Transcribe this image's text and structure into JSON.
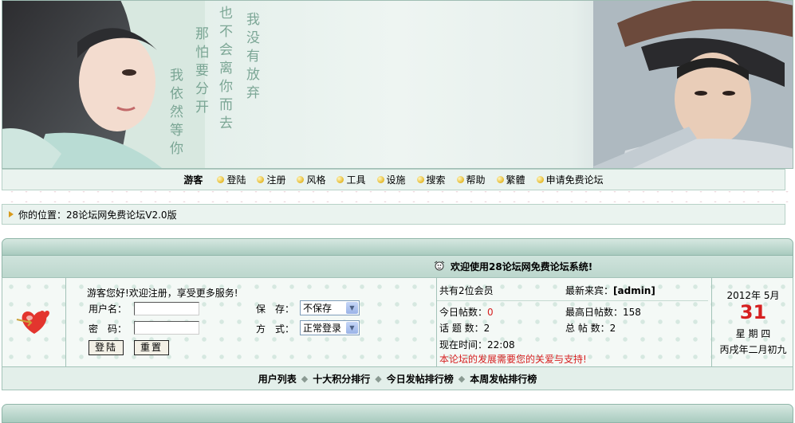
{
  "banner": {
    "poem": [
      "我没有放弃",
      "也不会离你而去",
      "那怕要分开",
      "我依然等你"
    ]
  },
  "nav": {
    "guest": "游客",
    "items": [
      "登陆",
      "注册",
      "风格",
      "工具",
      "设施",
      "搜索",
      "帮助",
      "繁體",
      "申请免费论坛"
    ]
  },
  "breadcrumb": {
    "text": "你的位置：28论坛网免费论坛V2.0版"
  },
  "welcome": {
    "text": "欢迎使用28论坛网免费论坛系统!"
  },
  "login": {
    "greeting": "游客您好!欢迎注册，享受更多服务!",
    "username_label": "用户名：",
    "password_label": "密　码：",
    "save_label": "保　存：",
    "save_value": "不保存",
    "mode_label": "方　式：",
    "mode_value": "正常登录",
    "login_button": "登陆",
    "reset_button": "重置"
  },
  "stats": {
    "members": "共有2位会员",
    "newest_label": "最新来宾：",
    "newest_user": "[admin]",
    "today_label": "今日帖数：",
    "today_value": "0",
    "max_label": "最高日帖数：",
    "max_value": "158",
    "topics_label": "话 题 数：",
    "topics_value": "2",
    "total_label": "总 帖 数：",
    "total_value": "2",
    "time_label": "现在时间：",
    "time_value": "22:08",
    "support": "本论坛的发展需要您的关爱与支持!"
  },
  "calendar": {
    "year_month": "2012年  5月",
    "day": "31",
    "weekday": "星 期 四",
    "lunar": "丙戌年二月初九"
  },
  "bottom_links": [
    "用户列表",
    "十大积分排行",
    "今日发帖排行榜",
    "本周发帖排行榜"
  ],
  "colors": {
    "accent_red": "#d62020",
    "panel_green": "#bcd7cd"
  }
}
